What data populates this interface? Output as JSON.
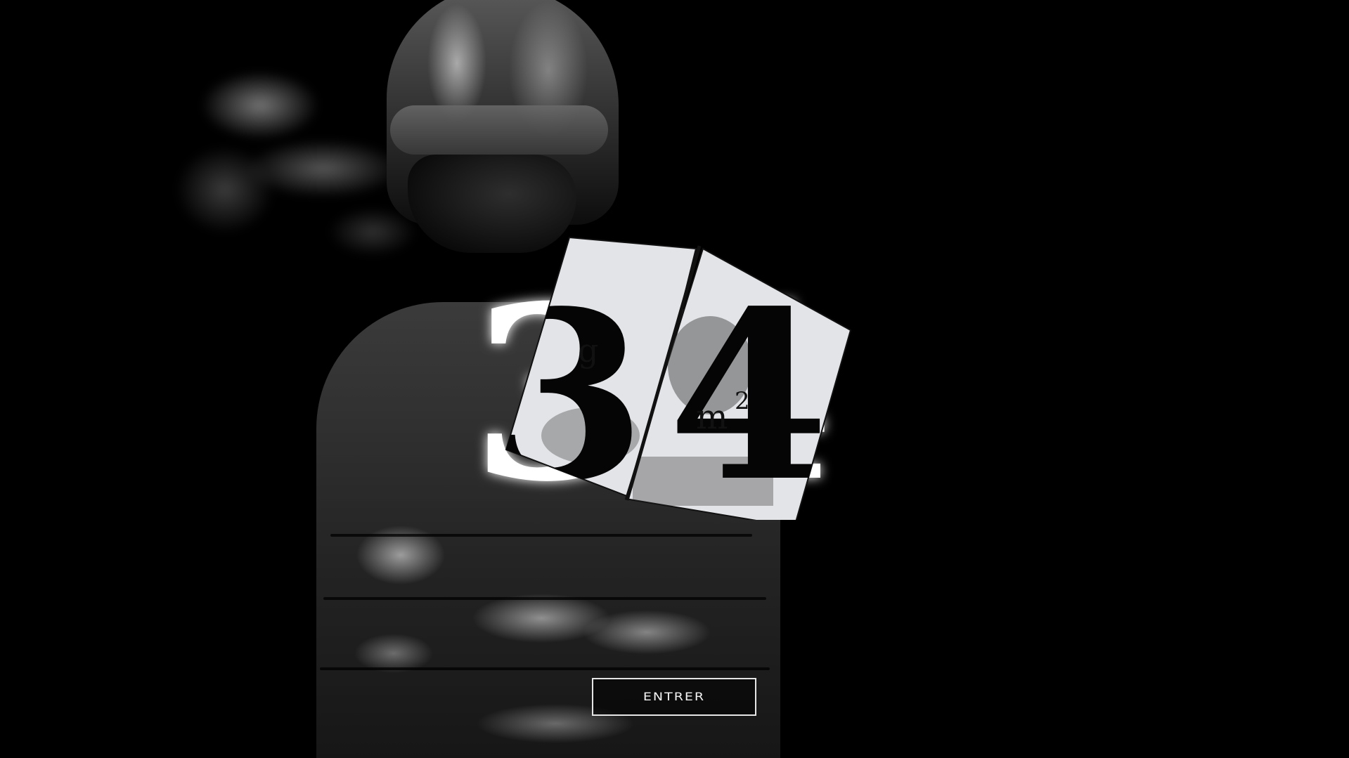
{
  "hero": {
    "background_image": "figure-in-puffer-jacket-photo",
    "smoke": "breath-smoke"
  },
  "logo": {
    "mark": "34",
    "digit_left": "3",
    "digit_right": "4",
    "inset_glyphs": [
      "g",
      "m",
      "2"
    ]
  },
  "enter_button": {
    "label": "ENTRER"
  },
  "colors": {
    "background": "#000000",
    "logo_panel": "#e3e4e8",
    "logo_glyph": "#000000",
    "glow": "#ffffff",
    "button_border": "#e6e6e6"
  }
}
